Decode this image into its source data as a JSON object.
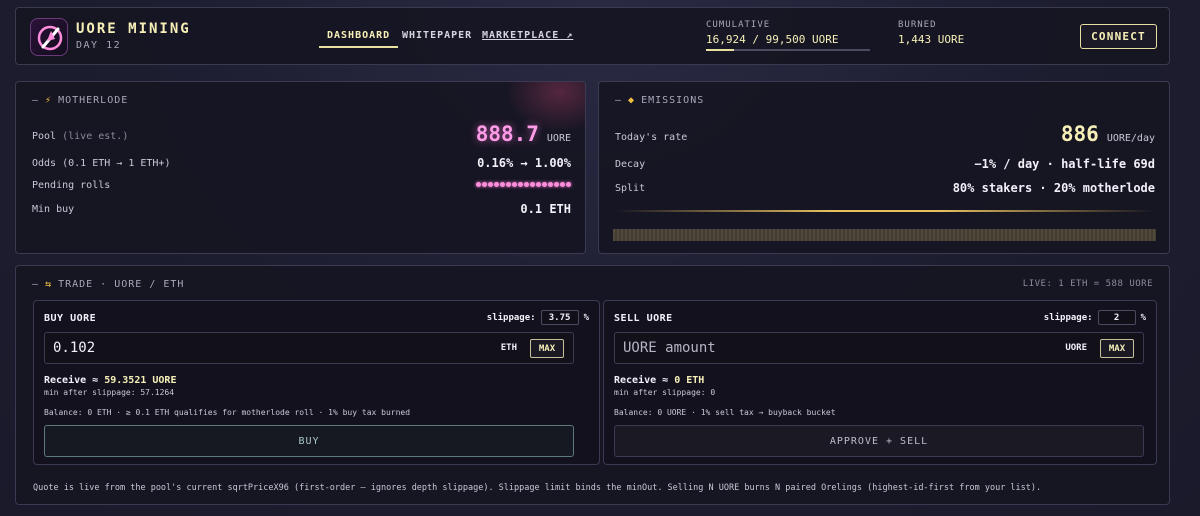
{
  "brand": {
    "title": "UORE MINING",
    "day": "DAY 12"
  },
  "nav": {
    "dashboard": "DASHBOARD",
    "whitepaper": "WHITEPAPER",
    "marketplace": "MARKETPLACE ↗"
  },
  "stats": {
    "cumulative_label": "CUMULATIVE",
    "cumulative_value": "16,924 / 99,500 UORE",
    "cumulative_progress": 0.17,
    "burned_label": "BURNED",
    "burned_value": "1,443 UORE"
  },
  "connect_label": "CONNECT",
  "motherlode": {
    "head_prefix": "—",
    "icon": "⚡",
    "title": "MOTHERLODE",
    "pool_label": "Pool",
    "pool_note": "(live est.)",
    "pool_value": "888.7",
    "pool_unit": "UORE",
    "odds_label": "Odds (0.1 ETH → 1 ETH+)",
    "odds_value": "0.16% → 1.00%",
    "pending_label": "Pending rolls",
    "pending_count": 16,
    "minbuy_label": "Min buy",
    "minbuy_value": "0.1 ETH"
  },
  "emissions": {
    "head_prefix": "—",
    "icon": "◆",
    "title": "EMISSIONS",
    "rate_label": "Today's rate",
    "rate_value": "886",
    "rate_unit": "UORE/day",
    "decay_label": "Decay",
    "decay_value": "−1% / day · half-life 69d",
    "split_label": "Split",
    "split_value": "80% stakers · 20% motherlode"
  },
  "trade": {
    "head_prefix": "—",
    "icon": "⇆",
    "title": "TRADE · UORE / ETH",
    "live_rate": "LIVE: 1 ETH = 588 UORE",
    "buy": {
      "title": "BUY UORE",
      "slippage_label": "slippage:",
      "slippage_value": "3.75",
      "pct": "%",
      "amount_value": "0.102",
      "unit": "ETH",
      "max_label": "MAX",
      "receive_label": "Receive ≈",
      "receive_value": "59.3521 UORE",
      "min_after": "min after slippage: 57.1264",
      "balance": "Balance: 0 ETH · ≥ 0.1 ETH qualifies for motherlode roll · 1% buy tax burned",
      "button": "BUY"
    },
    "sell": {
      "title": "SELL UORE",
      "slippage_label": "slippage:",
      "slippage_value": "2",
      "pct": "%",
      "amount_placeholder": "UORE amount",
      "unit": "UORE",
      "max_label": "MAX",
      "receive_label": "Receive ≈",
      "receive_value": "0 ETH",
      "min_after": "min after slippage: 0",
      "balance": "Balance: 0 UORE · 1% sell tax → buyback bucket",
      "button": "APPROVE + SELL"
    },
    "footnote": "Quote is live from the pool's current sqrtPriceX96 (first-order — ignores depth slippage). Slippage limit binds the minOut. Selling N UORE burns N paired Orelings (highest-id-first from your list)."
  }
}
